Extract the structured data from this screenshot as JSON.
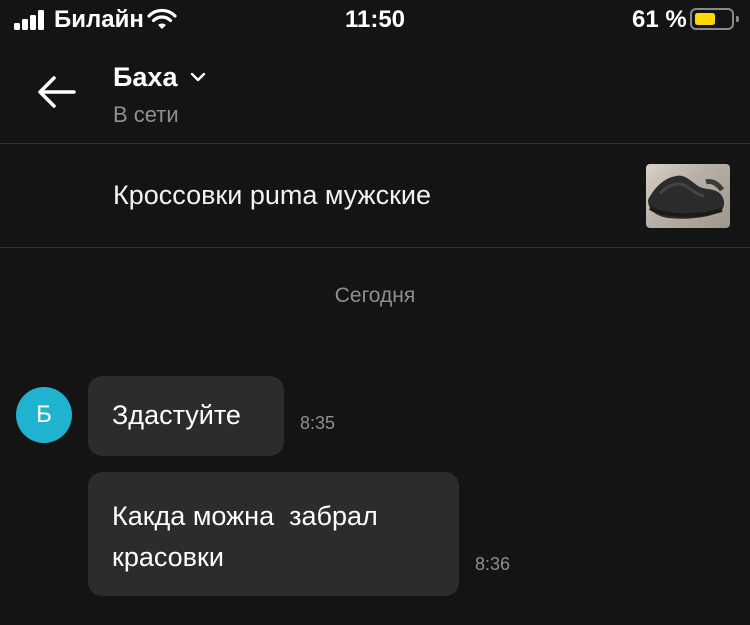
{
  "status_bar": {
    "carrier": "Билайн",
    "time": "11:50",
    "battery_percent": "61 %",
    "battery_level": 0.61,
    "battery_color": "#ffd60a",
    "icons": [
      "signal-icon",
      "wifi-icon",
      "battery-icon"
    ]
  },
  "header": {
    "back_icon": "arrow-left-icon",
    "contact_name": "Баха",
    "chevron_icon": "chevron-down-icon",
    "contact_status": "В сети"
  },
  "product": {
    "title": "Кроссовки puma мужские",
    "thumbnail": "sneakers-photo"
  },
  "chat": {
    "date_separator": "Сегодня",
    "avatar_letter": "Б",
    "avatar_color": "#1fb3cf",
    "messages": [
      {
        "text": "Здастуйте",
        "time": "8:35"
      },
      {
        "text_lines": [
          "Какда можна  забрал",
          "красовки"
        ],
        "time": "8:36"
      }
    ]
  }
}
